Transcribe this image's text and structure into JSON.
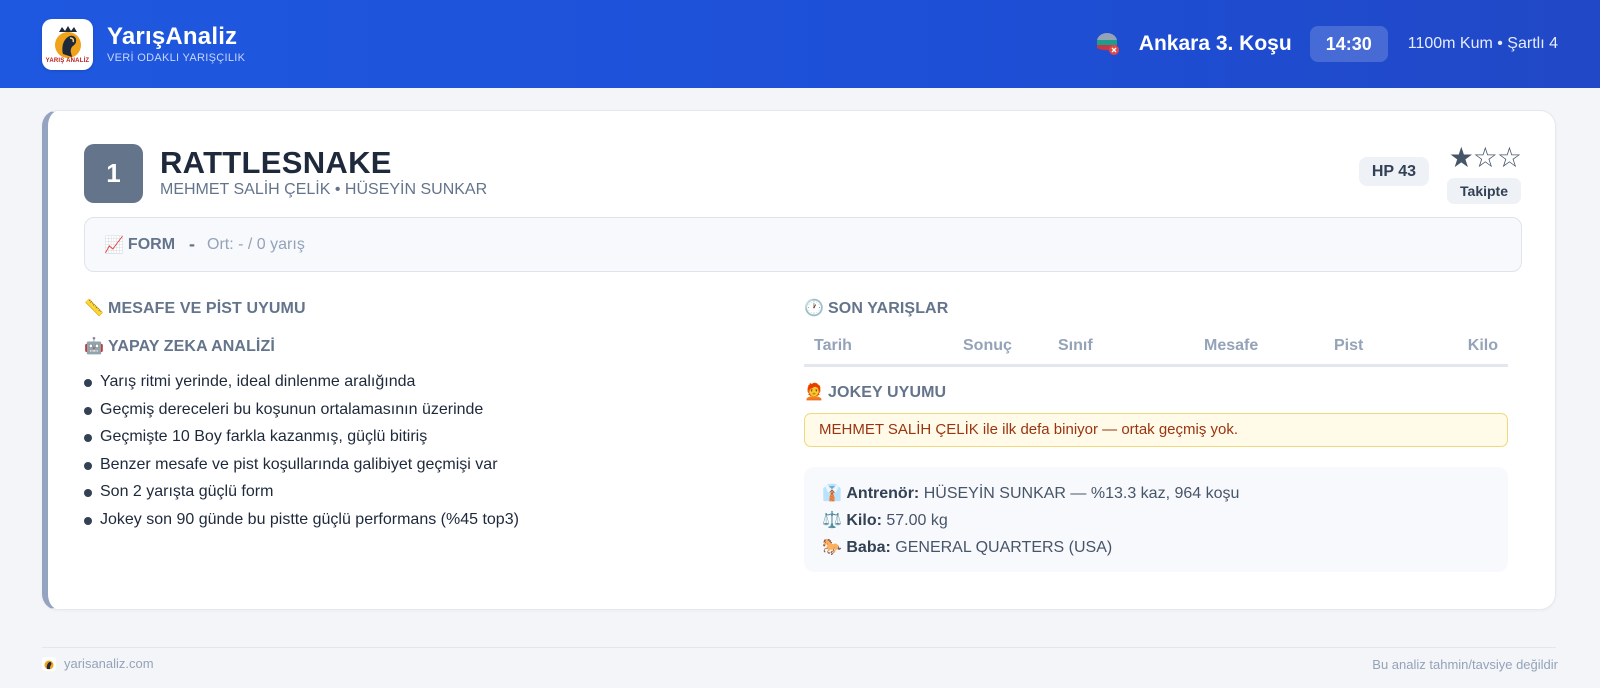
{
  "header": {
    "brand_name": "YarışAnaliz",
    "brand_subtitle": "VERİ ODAKLI YARIŞÇILIK",
    "logo_text": "YARIŞ ANALİZ",
    "race_name": "Ankara 3. Koşu",
    "race_time": "14:30",
    "race_meta": "1100m Kum • Şartlı 4",
    "race_icon": "jockey-cap-icon"
  },
  "horse": {
    "number": "1",
    "name": "RATTLESNAKE",
    "subtitle": "MEHMET SALİH ÇELİK • HÜSEYİN SUNKAR",
    "hp": "HP 43",
    "rating_stars": 1,
    "rating_max": 3,
    "stars_display": "★☆☆",
    "follow_label": "Takipte"
  },
  "form": {
    "icon": "📈",
    "label": "FORM",
    "value": "-",
    "average": "Ort: - / 0 yarış"
  },
  "sections": {
    "distance": {
      "icon": "📏",
      "title": "MESAFE VE PİST UYUMU"
    },
    "ai": {
      "icon": "🤖",
      "title": "YAPAY ZEKA ANALİZİ"
    },
    "recent": {
      "icon": "🕐",
      "title": "SON YARIŞLAR"
    },
    "jockey": {
      "icon": "🧑‍🦰",
      "title": "JOKEY UYUMU"
    }
  },
  "ai_points": [
    "Yarış ritmi yerinde, ideal dinlenme aralığında",
    "Geçmiş dereceleri bu koşunun ortalamasının üzerinde",
    "Geçmişte 10 Boy farkla kazanmış, güçlü bitiriş",
    "Benzer mesafe ve pist koşullarında galibiyet geçmişi var",
    "Son 2 yarışta güçlü form",
    "Jokey son 90 günde bu pistte güçlü performans (%45 top3)"
  ],
  "recent_table": {
    "columns": [
      "Tarih",
      "Sonuç",
      "Sınıf",
      "Mesafe",
      "Pist",
      "Kilo"
    ],
    "rows": []
  },
  "jockey_note": "MEHMET SALİH ÇELİK ile ilk defa biniyor — ortak geçmiş yok.",
  "details": {
    "trainer_icon": "👔",
    "trainer_label": "Antrenör:",
    "trainer_value": "HÜSEYİN SUNKAR — %13.3 kaz, 964 koşu",
    "weight_icon": "⚖️",
    "weight_label": "Kilo:",
    "weight_value": "57.00 kg",
    "sire_icon": "🐎",
    "sire_label": "Baba:",
    "sire_value": "GENERAL QUARTERS (USA)"
  },
  "footer": {
    "site": "yarisanaliz.com",
    "disclaimer": "Bu analiz tahmin/tavsiye değildir"
  },
  "colors": {
    "header_bg": "#1f58e0",
    "card_accent": "#94a3bf",
    "number_badge": "#64748b",
    "warning_bg": "#fffbe8",
    "warning_text": "#9a3412"
  }
}
